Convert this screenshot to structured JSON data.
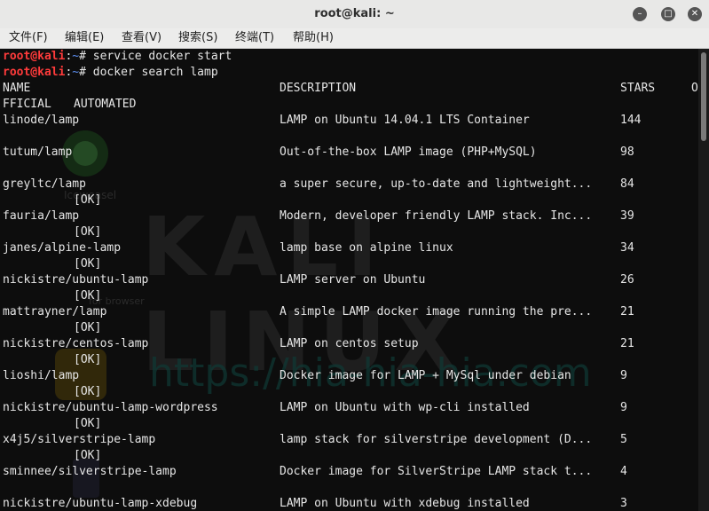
{
  "window": {
    "title": "root@kali: ~",
    "controls": [
      "minimize-icon",
      "maximize-icon",
      "close-icon"
    ]
  },
  "menu": [
    "文件(F)",
    "编辑(E)",
    "查看(V)",
    "搜索(S)",
    "终端(T)",
    "帮助(H)"
  ],
  "terminal": {
    "prompt_user": "root@kali",
    "prompt_sep": ":",
    "prompt_path": "~",
    "prompt_end": "# ",
    "commands": [
      "service docker start",
      "docker search lamp"
    ],
    "header": {
      "name": "NAME",
      "description": "DESCRIPTION",
      "stars": "STARS",
      "official_a": "O",
      "official_b": "FFICIAL",
      "automated": "AUTOMATED"
    },
    "rows": [
      {
        "name": "linode/lamp",
        "description": "LAMP on Ubuntu 14.04.1 LTS Container",
        "stars": "144",
        "automated": ""
      },
      {
        "name": "tutum/lamp",
        "description": "Out-of-the-box LAMP image (PHP+MySQL)",
        "stars": "98",
        "automated": ""
      },
      {
        "name": "greyltc/lamp",
        "description": "a super secure, up-to-date and lightweight...",
        "stars": "84",
        "automated": "[OK]"
      },
      {
        "name": "fauria/lamp",
        "description": "Modern, developer friendly LAMP stack. Inc...",
        "stars": "39",
        "automated": "[OK]"
      },
      {
        "name": "janes/alpine-lamp",
        "description": "lamp base on alpine linux",
        "stars": "34",
        "automated": "[OK]"
      },
      {
        "name": "nickistre/ubuntu-lamp",
        "description": "LAMP server on Ubuntu",
        "stars": "26",
        "automated": "[OK]"
      },
      {
        "name": "mattrayner/lamp",
        "description": "A simple LAMP docker image running the pre...",
        "stars": "21",
        "automated": "[OK]"
      },
      {
        "name": "nickistre/centos-lamp",
        "description": "LAMP on centos setup",
        "stars": "21",
        "automated": "[OK]"
      },
      {
        "name": "lioshi/lamp",
        "description": "Docker image for LAMP + MySql under debian",
        "stars": "9",
        "automated": "[OK]"
      },
      {
        "name": "nickistre/ubuntu-lamp-wordpress",
        "description": "LAMP on Ubuntu with wp-cli installed",
        "stars": "9",
        "automated": "[OK]"
      },
      {
        "name": "x4j5/silverstripe-lamp",
        "description": "lamp stack for silverstripe development (D...",
        "stars": "5",
        "automated": "[OK]"
      },
      {
        "name": "sminnee/silverstripe-lamp",
        "description": "Docker image for SilverStripe LAMP stack t...",
        "stars": "4",
        "automated": ""
      },
      {
        "name": "nickistre/ubuntu-lamp-xdebug",
        "description": "LAMP on Ubuntu with xdebug installed",
        "stars": "3",
        "automated": ""
      }
    ]
  },
  "watermark": {
    "brand": "KALI LINUX",
    "url": "https://hia-hia-hia.com",
    "text1": "Iceweasel",
    "text2": "for browser"
  },
  "colors": {
    "prompt_user": "#ff3b3b",
    "prompt_path": "#5c8ef0",
    "terminal_bg": "#0d0d0d",
    "terminal_text": "#e6e6e6"
  }
}
